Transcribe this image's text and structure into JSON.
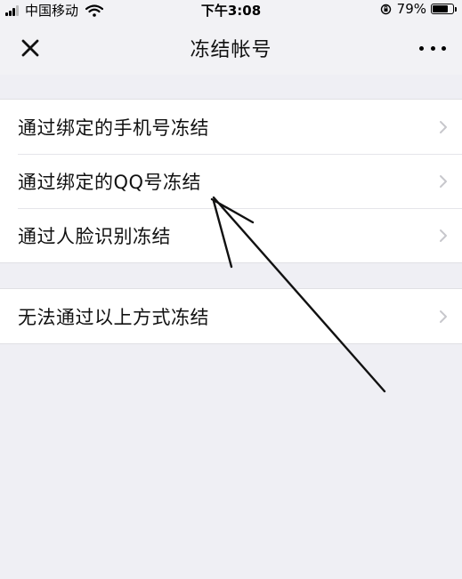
{
  "status_bar": {
    "carrier": "中国移动",
    "time": "下午3:08",
    "battery_percent": "79%",
    "battery_level": 0.79,
    "icons": [
      "signal-icon",
      "wifi-icon",
      "rotation-lock-icon",
      "battery-icon"
    ]
  },
  "nav": {
    "title": "冻结帐号",
    "close_icon": "close-icon",
    "more_icon": "more-icon"
  },
  "menu_groups": [
    {
      "items": [
        {
          "label": "通过绑定的手机号冻结"
        },
        {
          "label": "通过绑定的QQ号冻结"
        },
        {
          "label": "通过人脸识别冻结"
        }
      ]
    },
    {
      "items": [
        {
          "label": "无法通过以上方式冻结"
        }
      ]
    }
  ],
  "colors": {
    "background": "#efeff4",
    "row_background": "#ffffff",
    "chevron": "#c7c7cc",
    "annotation_stroke": "#111111"
  }
}
